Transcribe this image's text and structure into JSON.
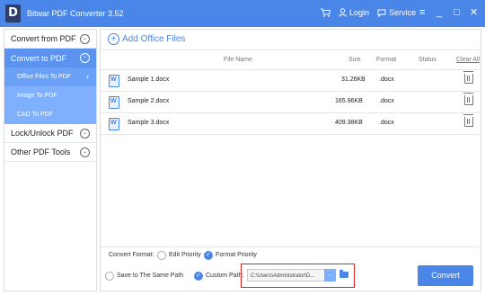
{
  "app": {
    "logo_letter": "D",
    "title": "Bitwar PDF Converter 3.52"
  },
  "titlebar": {
    "cart_icon": "cart-icon",
    "login": "Login",
    "service": "Service",
    "menu_icon": "hamburger-icon",
    "minimize": "_",
    "maximize": "□",
    "close": "✕"
  },
  "sidebar": {
    "groups": [
      {
        "label": "Convert from PDF",
        "icon": "chevron-down-icon"
      },
      {
        "label": "Convert to PDF",
        "icon": "chevron-right-icon"
      },
      {
        "label": "Lock/Unlock PDF",
        "icon": "chevron-down-icon"
      },
      {
        "label": "Other PDF Tools",
        "icon": "chevron-down-icon"
      }
    ],
    "sub_items": [
      {
        "label": "Office Files To PDF",
        "selected": true
      },
      {
        "label": "Image To PDF",
        "selected": false
      },
      {
        "label": "CAD To PDF",
        "selected": false
      }
    ]
  },
  "main": {
    "add_label": "Add Office Files",
    "columns": {
      "file_name": "File Name",
      "size": "Size",
      "format": "Format",
      "status": "Status",
      "clear_all": "Clear All"
    },
    "files": [
      {
        "name": "Sample 1.docx",
        "size": "31.26KB",
        "format": ".docx",
        "status": ""
      },
      {
        "name": "Sample 2.docx",
        "size": "165.96KB",
        "format": ".docx",
        "status": ""
      },
      {
        "name": "Sample 3.docx",
        "size": "409.38KB",
        "format": ".docx",
        "status": ""
      }
    ]
  },
  "options": {
    "convert_format_label": "Convert Format:",
    "edit_priority": "Edit Priority",
    "format_priority": "Format Priority",
    "save_same_path": "Save to The Same Path",
    "custom_path_label": "Custom Path:",
    "custom_path_value": "C:\\Users\\Administrator\\D...",
    "browse_dots": "...",
    "convert_button": "Convert"
  },
  "colors": {
    "accent": "#4a86e8",
    "highlight_border": "#e02020"
  }
}
